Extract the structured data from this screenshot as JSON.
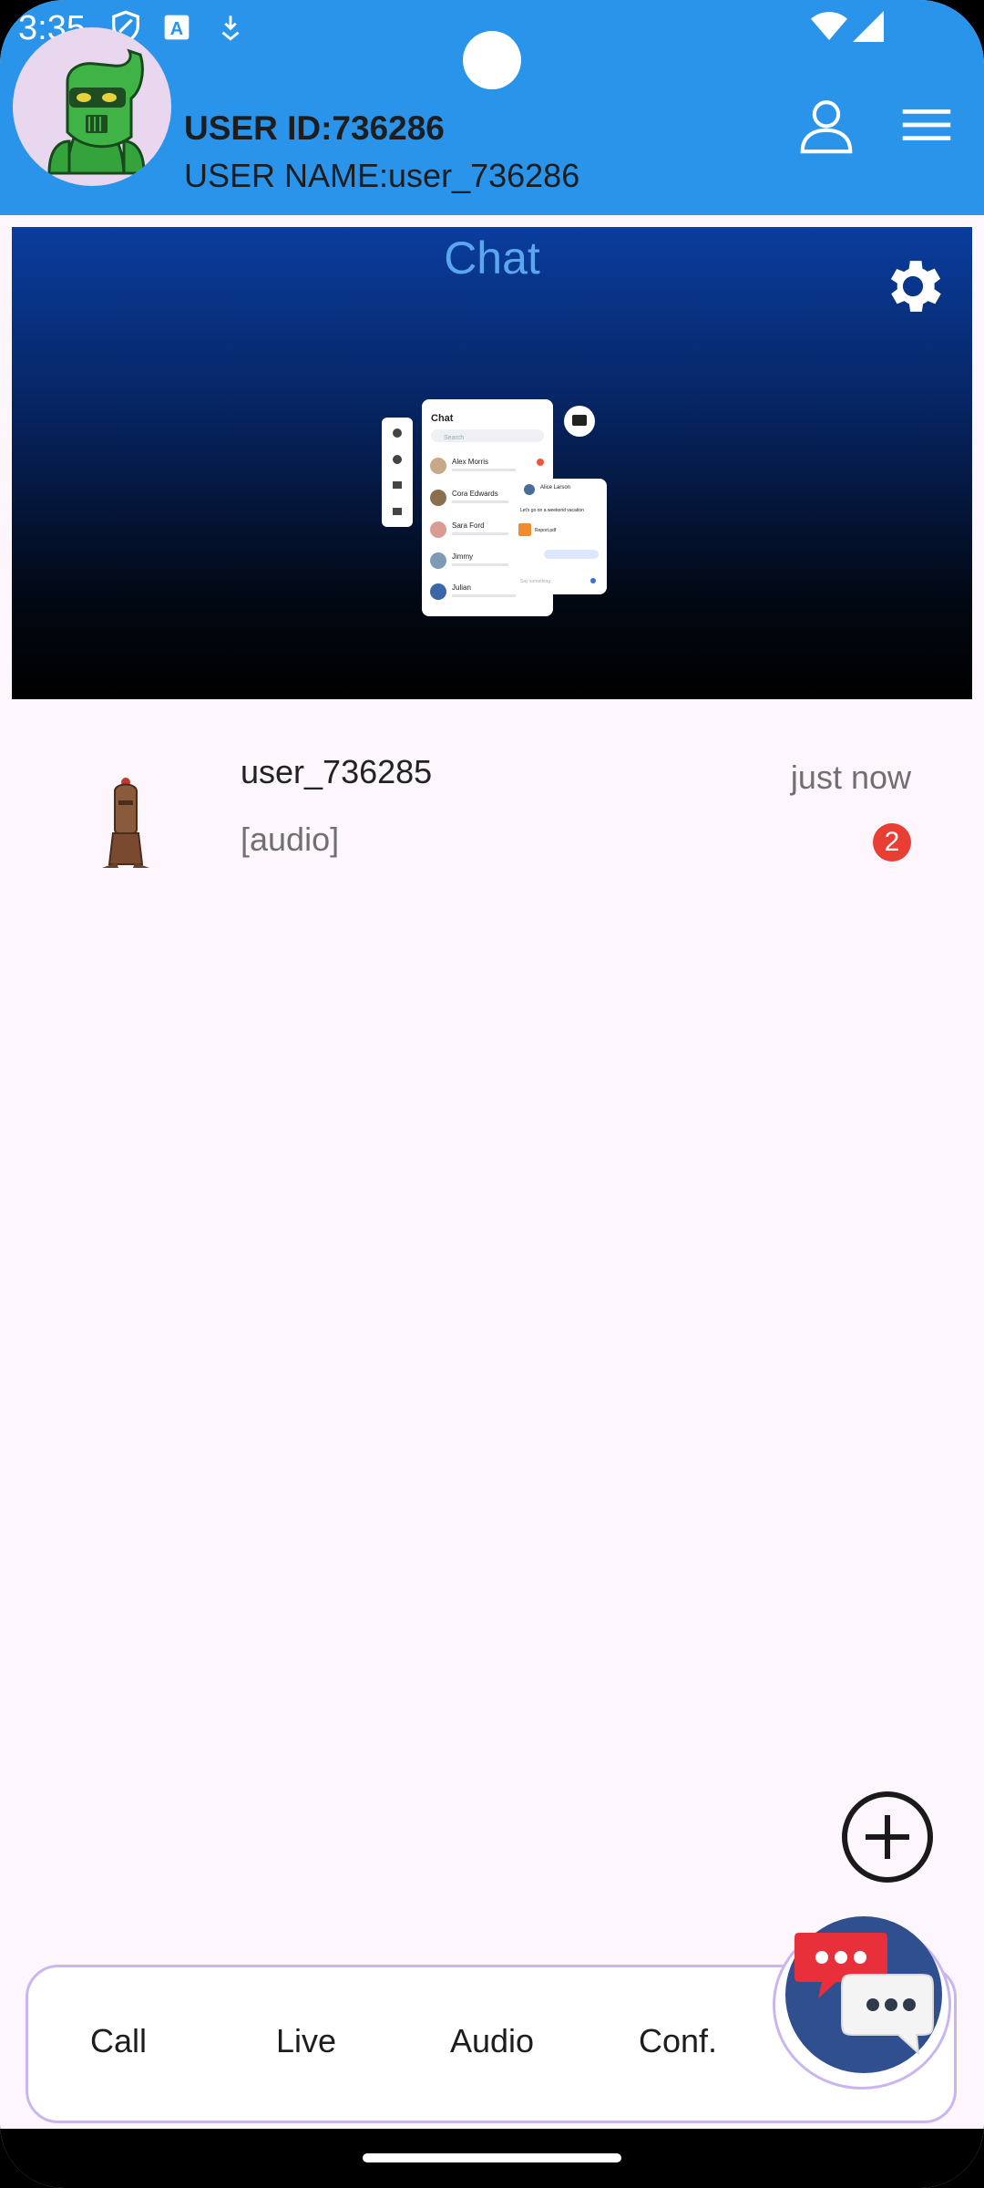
{
  "status_bar": {
    "time": "3:35"
  },
  "header": {
    "user_id": "USER ID:736286",
    "user_name": "USER NAME:user_736286"
  },
  "banner": {
    "title": "Chat",
    "preview": {
      "title": "Chat",
      "search_placeholder": "Search",
      "contacts": [
        "Alex Morris",
        "Cora Edwards",
        "Sara Ford",
        "Jimmy",
        "Julian"
      ],
      "detail_name": "Alice Larson",
      "detail_message": "Let's go on a weekend vacation",
      "detail_file": "Report.pdf",
      "detail_input": "Say something"
    }
  },
  "conversations": [
    {
      "name": "user_736285",
      "last_message": "[audio]",
      "time": "just now",
      "unread": "2"
    }
  ],
  "bottom_nav": {
    "items": [
      {
        "label": "Call"
      },
      {
        "label": "Live"
      },
      {
        "label": "Audio"
      },
      {
        "label": "Conf."
      }
    ]
  },
  "colors": {
    "header": "#2a93ea",
    "badge": "#e83e33",
    "banner_title": "#5aa7ef"
  }
}
